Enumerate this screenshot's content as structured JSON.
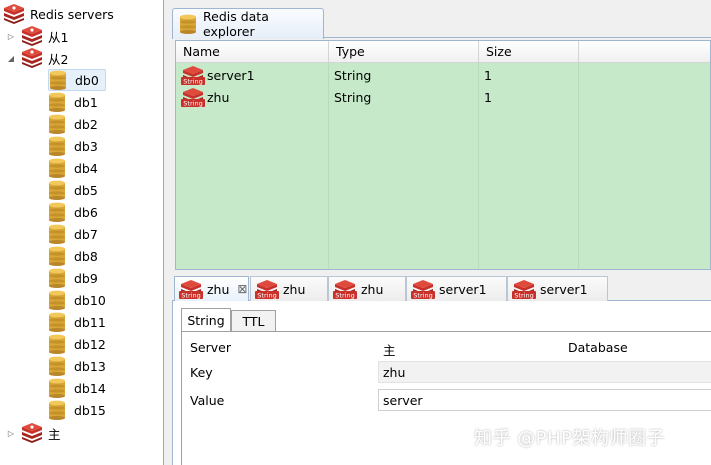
{
  "tree": {
    "root_label": "Redis servers",
    "servers": [
      {
        "label": "从1",
        "expanded": false
      },
      {
        "label": "从2",
        "expanded": true,
        "dbs": [
          "db0",
          "db1",
          "db2",
          "db3",
          "db4",
          "db5",
          "db6",
          "db7",
          "db8",
          "db9",
          "db10",
          "db11",
          "db12",
          "db13",
          "db14",
          "db15"
        ],
        "selected_db": "db0"
      },
      {
        "label": "主",
        "expanded": false
      }
    ]
  },
  "explorer": {
    "tab_title": "Redis data explorer",
    "columns": [
      "Name",
      "Type",
      "Size"
    ],
    "rows": [
      {
        "icon": "String",
        "name": "server1",
        "type": "String",
        "size": "1"
      },
      {
        "icon": "String",
        "name": "zhu",
        "type": "String",
        "size": "1"
      }
    ]
  },
  "key_tabs": [
    {
      "label": "zhu",
      "icon": "String",
      "active": true
    },
    {
      "label": "zhu",
      "icon": "String",
      "active": false
    },
    {
      "label": "zhu",
      "icon": "String",
      "active": false
    },
    {
      "label": "server1",
      "icon": "String",
      "active": false
    },
    {
      "label": "server1",
      "icon": "String",
      "active": false
    }
  ],
  "detail": {
    "subtabs": [
      "String",
      "TTL"
    ],
    "server_label": "Server",
    "server_value": "主",
    "database_label": "Database",
    "key_label": "Key",
    "key_value": "zhu",
    "value_label": "Value",
    "value_value": "server"
  },
  "watermark": "知乎 @PHP架构师圈子",
  "colors": {
    "grid_bg": "#c6eac9",
    "accent_border": "#9fb5d0",
    "redis_red": "#c8302a",
    "db_gold": "#d8a636"
  }
}
